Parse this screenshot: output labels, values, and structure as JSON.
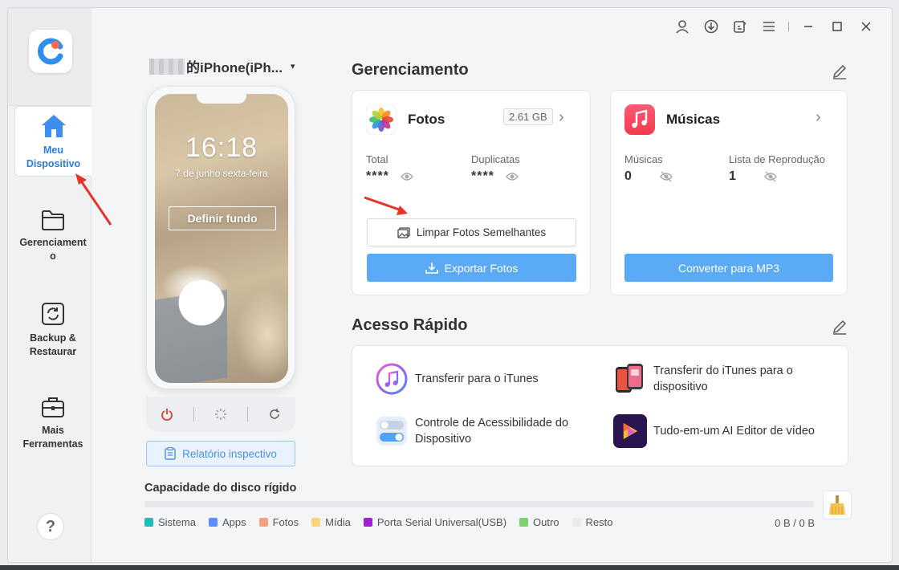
{
  "sidebar": {
    "items": [
      {
        "label": "Meu Dispositivo",
        "icon": "home-icon",
        "active": true
      },
      {
        "label": "Gerenciamento",
        "icon": "folder-icon",
        "active": false
      },
      {
        "label": "Backup & Restaurar",
        "icon": "backup-icon",
        "active": false
      },
      {
        "label": "Mais Ferramentas",
        "icon": "toolbox-icon",
        "active": false
      }
    ],
    "help_label": "?"
  },
  "device": {
    "name": "的iPhone(iPh...",
    "lock_time": "16:18",
    "lock_date": "7 de junho sexta-feira",
    "set_background_label": "Definir fundo",
    "report_label": "Relatório inspectivo"
  },
  "management": {
    "title": "Gerenciamento",
    "photos": {
      "title": "Fotos",
      "size": "2.61 GB",
      "total_label": "Total",
      "total_value": "****",
      "duplicates_label": "Duplicatas",
      "duplicates_value": "****",
      "clean_button": "Limpar Fotos Semelhantes",
      "export_button": "Exportar Fotos"
    },
    "music": {
      "title": "Músicas",
      "songs_label": "Músicas",
      "songs_value": "0",
      "playlist_label": "Lista de Reprodução",
      "playlist_value": "1",
      "convert_button": "Converter para MP3"
    }
  },
  "quick_access": {
    "title": "Acesso Rápido",
    "items": [
      {
        "label": "Transferir para o iTunes",
        "icon": "itunes-icon"
      },
      {
        "label": "Transferir do iTunes para o dispositivo",
        "icon": "phone-transfer-icon"
      },
      {
        "label": "Controle de Acessibilidade do Dispositivo",
        "icon": "toggle-icon"
      },
      {
        "label": "Tudo-em-um AI Editor de vídeo",
        "icon": "video-editor-icon"
      }
    ]
  },
  "disk": {
    "title": "Capacidade do disco rígido",
    "total": "0 B / 0 B",
    "legend": [
      {
        "label": "Sistema",
        "color": "#1bbfb6"
      },
      {
        "label": "Apps",
        "color": "#5b8ff9"
      },
      {
        "label": "Fotos",
        "color": "#f6a27e"
      },
      {
        "label": "Mídia",
        "color": "#ffd27f"
      },
      {
        "label": "Porta Serial Universal(USB)",
        "color": "#a11fd1"
      },
      {
        "label": "Outro",
        "color": "#7cd26d"
      },
      {
        "label": "Resto",
        "color": "#e9eaec"
      }
    ]
  },
  "colors": {
    "accent": "#2a7de1",
    "button_blue": "#5aaaf5",
    "annotation_red": "#e8322a"
  }
}
